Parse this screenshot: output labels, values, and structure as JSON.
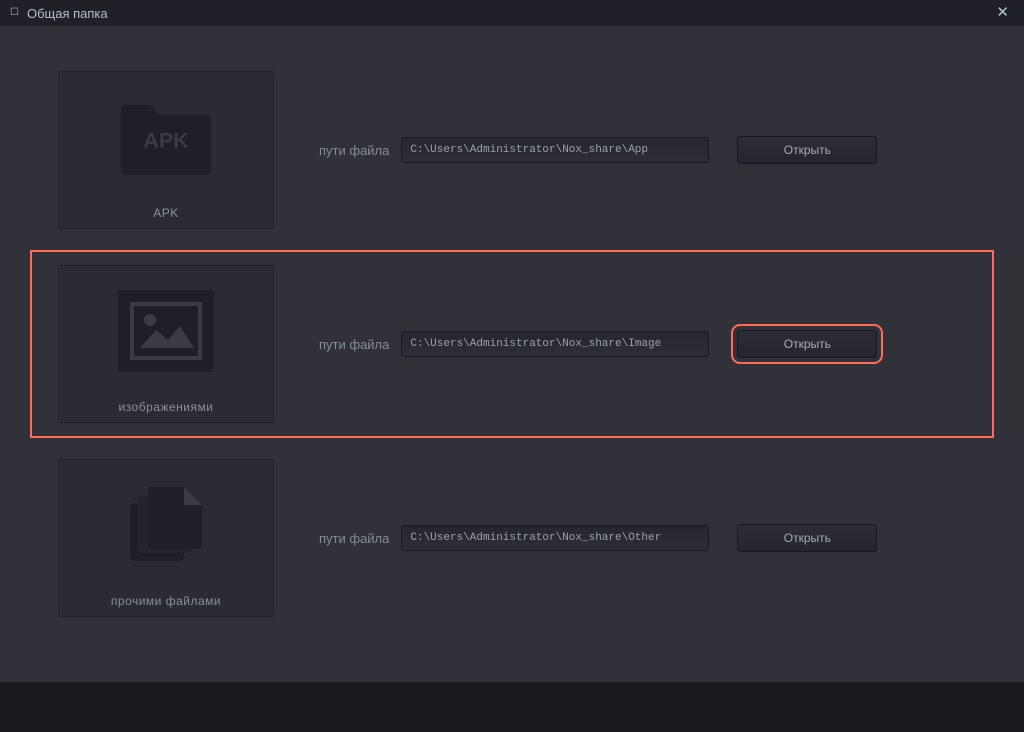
{
  "window": {
    "title": "Общая папка"
  },
  "labels": {
    "path": "пути файла",
    "open": "Открыть"
  },
  "rows": {
    "apk": {
      "card_label": "APK",
      "folder_text": "APK",
      "path": "C:\\Users\\Administrator\\Nox_share\\App"
    },
    "images": {
      "card_label": "изображениями",
      "path": "C:\\Users\\Administrator\\Nox_share\\Image"
    },
    "other": {
      "card_label": "прочими файлами",
      "path": "C:\\Users\\Administrator\\Nox_share\\Other"
    }
  },
  "colors": {
    "highlight": "#ff6b57",
    "bg": "#303139"
  }
}
